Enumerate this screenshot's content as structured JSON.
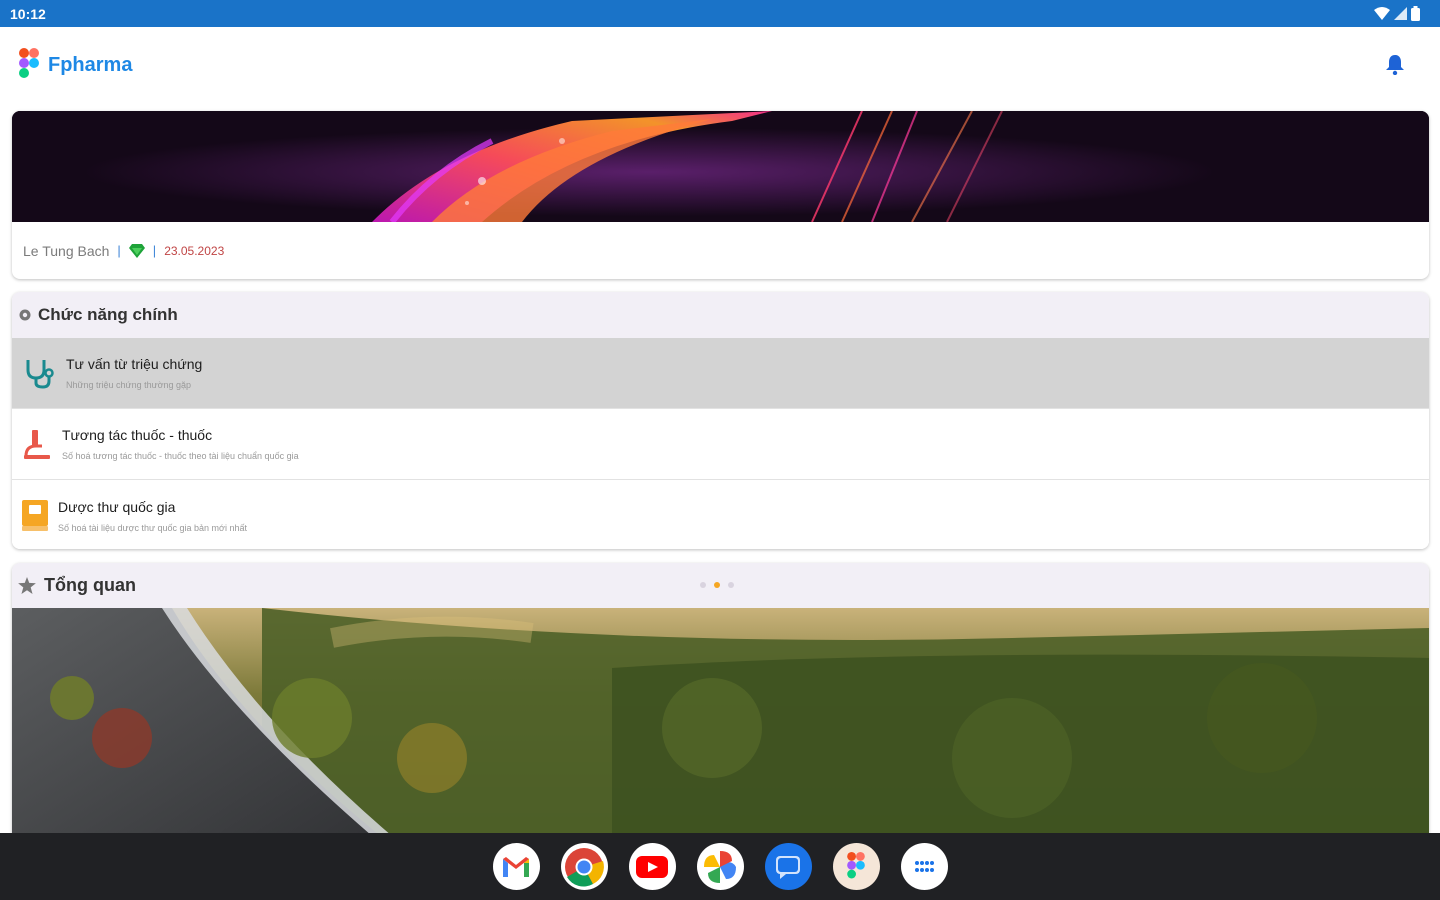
{
  "status_bar": {
    "time": "10:12",
    "icons": [
      "wifi-icon",
      "signal-icon",
      "battery-icon"
    ]
  },
  "app_bar": {
    "title": "Fpharma",
    "logo_icon": "fpharma-logo-icon",
    "notification_icon": "bell-icon"
  },
  "profile": {
    "name": "Le Tung Bach",
    "separator": "|",
    "date": "23.05.2023",
    "badge_icon": "diamond-badge-icon"
  },
  "features": {
    "header": "Chức năng chính",
    "header_icon": "gear-icon",
    "items": [
      {
        "title": "Tư vấn từ triệu chứng",
        "subtitle": "Những triệu chứng thường gặp",
        "icon": "stethoscope-icon"
      },
      {
        "title": "Tương tác thuốc - thuốc",
        "subtitle": "Số hoá tương tác thuốc - thuốc theo tài liệu chuẩn quốc gia",
        "icon": "microscope-icon"
      },
      {
        "title": "Dược thư quốc gia",
        "subtitle": "Số hoá tài liệu dược thư quốc gia bản mới nhất",
        "icon": "book-icon"
      }
    ]
  },
  "overview": {
    "header": "Tổng quan",
    "header_icon": "star-icon",
    "carousel_pages": 3,
    "carousel_active": 2
  },
  "taskbar": {
    "apps": [
      "gmail-icon",
      "chrome-icon",
      "youtube-icon",
      "photos-icon",
      "messages-icon",
      "fpharma-icon",
      "app-drawer-icon"
    ]
  },
  "colors": {
    "status_bar": "#1a73c8",
    "brand": "#1e88e5",
    "section_header": "#f2eff6",
    "active_row": "#d3d3d3",
    "date": "#c04545",
    "taskbar": "#202124"
  }
}
